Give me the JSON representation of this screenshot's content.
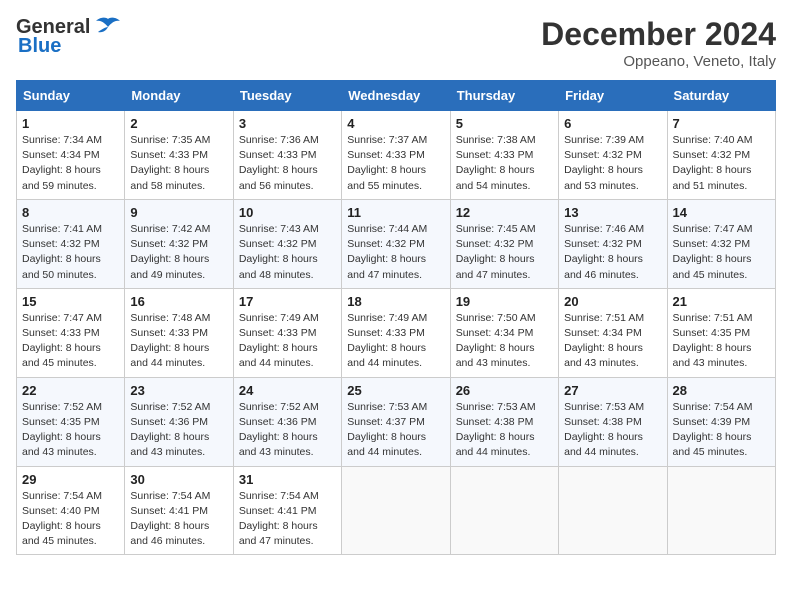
{
  "header": {
    "logo_general": "General",
    "logo_blue": "Blue",
    "month_title": "December 2024",
    "location": "Oppeano, Veneto, Italy"
  },
  "calendar": {
    "days_of_week": [
      "Sunday",
      "Monday",
      "Tuesday",
      "Wednesday",
      "Thursday",
      "Friday",
      "Saturday"
    ],
    "weeks": [
      [
        {
          "day": "",
          "empty": true
        },
        {
          "day": "",
          "empty": true
        },
        {
          "day": "",
          "empty": true
        },
        {
          "day": "",
          "empty": true
        },
        {
          "day": "",
          "empty": true
        },
        {
          "day": "",
          "empty": true
        },
        {
          "day": "",
          "empty": true
        }
      ],
      [
        {
          "day": "1",
          "sunrise": "7:34 AM",
          "sunset": "4:34 PM",
          "daylight": "8 hours and 59 minutes."
        },
        {
          "day": "2",
          "sunrise": "7:35 AM",
          "sunset": "4:33 PM",
          "daylight": "8 hours and 58 minutes."
        },
        {
          "day": "3",
          "sunrise": "7:36 AM",
          "sunset": "4:33 PM",
          "daylight": "8 hours and 56 minutes."
        },
        {
          "day": "4",
          "sunrise": "7:37 AM",
          "sunset": "4:33 PM",
          "daylight": "8 hours and 55 minutes."
        },
        {
          "day": "5",
          "sunrise": "7:38 AM",
          "sunset": "4:33 PM",
          "daylight": "8 hours and 54 minutes."
        },
        {
          "day": "6",
          "sunrise": "7:39 AM",
          "sunset": "4:32 PM",
          "daylight": "8 hours and 53 minutes."
        },
        {
          "day": "7",
          "sunrise": "7:40 AM",
          "sunset": "4:32 PM",
          "daylight": "8 hours and 51 minutes."
        }
      ],
      [
        {
          "day": "8",
          "sunrise": "7:41 AM",
          "sunset": "4:32 PM",
          "daylight": "8 hours and 50 minutes."
        },
        {
          "day": "9",
          "sunrise": "7:42 AM",
          "sunset": "4:32 PM",
          "daylight": "8 hours and 49 minutes."
        },
        {
          "day": "10",
          "sunrise": "7:43 AM",
          "sunset": "4:32 PM",
          "daylight": "8 hours and 48 minutes."
        },
        {
          "day": "11",
          "sunrise": "7:44 AM",
          "sunset": "4:32 PM",
          "daylight": "8 hours and 47 minutes."
        },
        {
          "day": "12",
          "sunrise": "7:45 AM",
          "sunset": "4:32 PM",
          "daylight": "8 hours and 47 minutes."
        },
        {
          "day": "13",
          "sunrise": "7:46 AM",
          "sunset": "4:32 PM",
          "daylight": "8 hours and 46 minutes."
        },
        {
          "day": "14",
          "sunrise": "7:47 AM",
          "sunset": "4:32 PM",
          "daylight": "8 hours and 45 minutes."
        }
      ],
      [
        {
          "day": "15",
          "sunrise": "7:47 AM",
          "sunset": "4:33 PM",
          "daylight": "8 hours and 45 minutes."
        },
        {
          "day": "16",
          "sunrise": "7:48 AM",
          "sunset": "4:33 PM",
          "daylight": "8 hours and 44 minutes."
        },
        {
          "day": "17",
          "sunrise": "7:49 AM",
          "sunset": "4:33 PM",
          "daylight": "8 hours and 44 minutes."
        },
        {
          "day": "18",
          "sunrise": "7:49 AM",
          "sunset": "4:33 PM",
          "daylight": "8 hours and 44 minutes."
        },
        {
          "day": "19",
          "sunrise": "7:50 AM",
          "sunset": "4:34 PM",
          "daylight": "8 hours and 43 minutes."
        },
        {
          "day": "20",
          "sunrise": "7:51 AM",
          "sunset": "4:34 PM",
          "daylight": "8 hours and 43 minutes."
        },
        {
          "day": "21",
          "sunrise": "7:51 AM",
          "sunset": "4:35 PM",
          "daylight": "8 hours and 43 minutes."
        }
      ],
      [
        {
          "day": "22",
          "sunrise": "7:52 AM",
          "sunset": "4:35 PM",
          "daylight": "8 hours and 43 minutes."
        },
        {
          "day": "23",
          "sunrise": "7:52 AM",
          "sunset": "4:36 PM",
          "daylight": "8 hours and 43 minutes."
        },
        {
          "day": "24",
          "sunrise": "7:52 AM",
          "sunset": "4:36 PM",
          "daylight": "8 hours and 43 minutes."
        },
        {
          "day": "25",
          "sunrise": "7:53 AM",
          "sunset": "4:37 PM",
          "daylight": "8 hours and 44 minutes."
        },
        {
          "day": "26",
          "sunrise": "7:53 AM",
          "sunset": "4:38 PM",
          "daylight": "8 hours and 44 minutes."
        },
        {
          "day": "27",
          "sunrise": "7:53 AM",
          "sunset": "4:38 PM",
          "daylight": "8 hours and 44 minutes."
        },
        {
          "day": "28",
          "sunrise": "7:54 AM",
          "sunset": "4:39 PM",
          "daylight": "8 hours and 45 minutes."
        }
      ],
      [
        {
          "day": "29",
          "sunrise": "7:54 AM",
          "sunset": "4:40 PM",
          "daylight": "8 hours and 45 minutes."
        },
        {
          "day": "30",
          "sunrise": "7:54 AM",
          "sunset": "4:41 PM",
          "daylight": "8 hours and 46 minutes."
        },
        {
          "day": "31",
          "sunrise": "7:54 AM",
          "sunset": "4:41 PM",
          "daylight": "8 hours and 47 minutes."
        },
        {
          "day": "",
          "empty": true
        },
        {
          "day": "",
          "empty": true
        },
        {
          "day": "",
          "empty": true
        },
        {
          "day": "",
          "empty": true
        }
      ]
    ]
  }
}
